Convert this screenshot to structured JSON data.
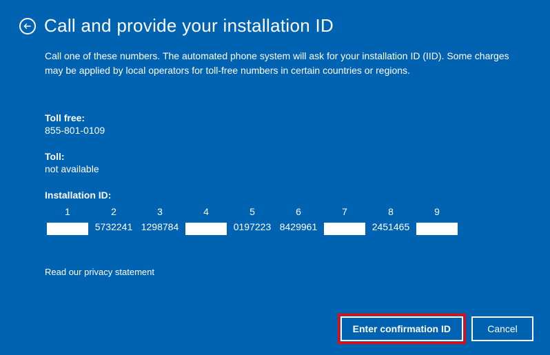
{
  "header": {
    "title": "Call and provide your installation ID"
  },
  "content": {
    "description": "Call one of these numbers. The automated phone system will ask for your installation ID (IID). Some charges may be applied by local operators for toll-free numbers in certain countries or regions.",
    "toll_free_label": "Toll free:",
    "toll_free_value": "855-801-0109",
    "toll_label": "Toll:",
    "toll_value": "not available",
    "iid_label": "Installation ID:",
    "iid_headers": [
      "1",
      "2",
      "3",
      "4",
      "5",
      "6",
      "7",
      "8",
      "9"
    ],
    "iid_values": [
      "",
      "5732241",
      "1298784",
      "",
      "0197223",
      "8429961",
      "",
      "2451465",
      ""
    ],
    "privacy_link": "Read our privacy statement"
  },
  "footer": {
    "primary_button": "Enter confirmation ID",
    "cancel_button": "Cancel"
  }
}
